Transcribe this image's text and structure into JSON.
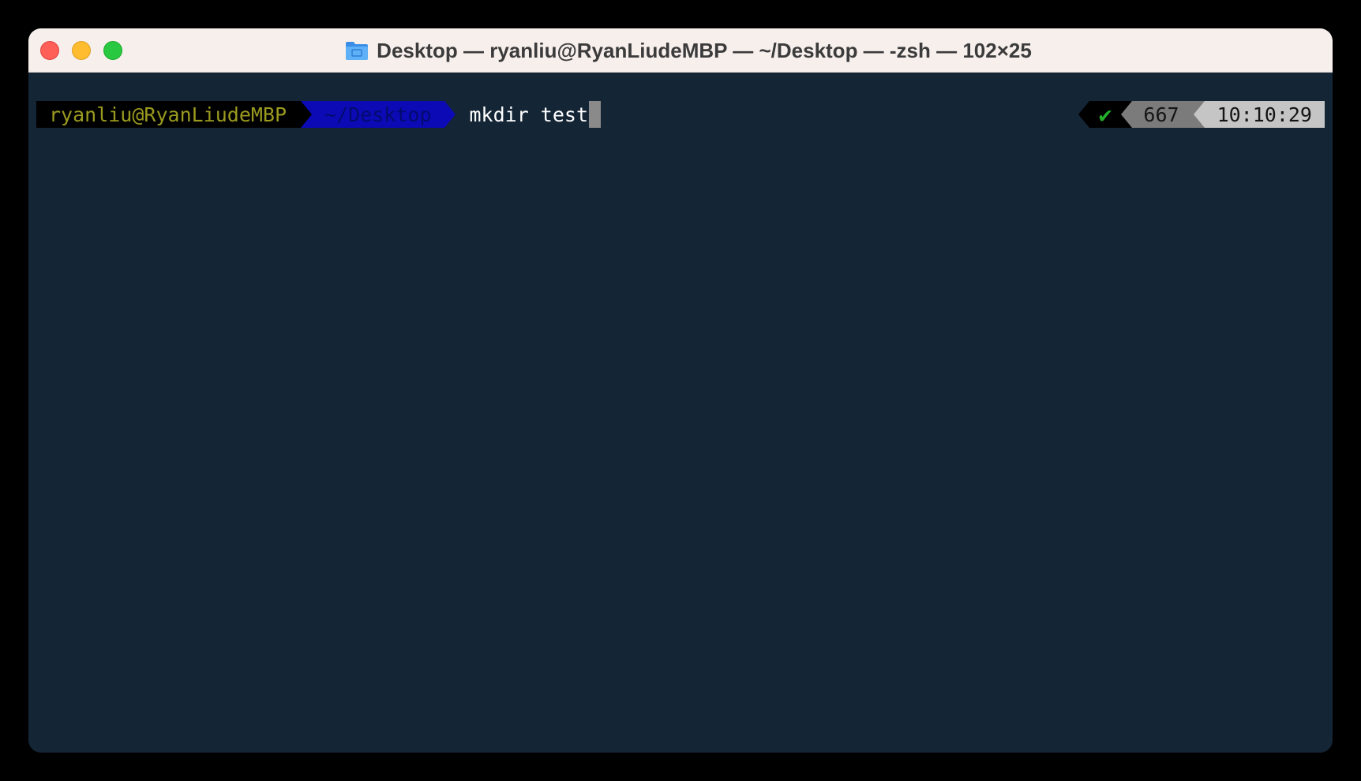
{
  "window": {
    "title": "Desktop — ryanliu@RyanLiudeMBP — ~/Desktop — -zsh — 102×25",
    "title_icon": "folder-icon",
    "controls": {
      "close": "close-icon",
      "minimize": "minimize-icon",
      "zoom": "zoom-icon"
    }
  },
  "prompt": {
    "user_host": "ryanliu@RyanLiudeMBP",
    "directory": "~/Desktop",
    "command": "mkdir test"
  },
  "right_prompt": {
    "status_symbol": "✔",
    "history_number": "667",
    "time": "10:10:29"
  },
  "colors": {
    "terminal_background": "#142536",
    "user_segment_bg": "#000000",
    "user_segment_fg": "#9a9a20",
    "directory_segment_bg": "#0b0ab5",
    "status_ok": "#22b02a",
    "count_segment_bg": "#7b7b7b",
    "time_segment_bg": "#c5c5c5"
  }
}
